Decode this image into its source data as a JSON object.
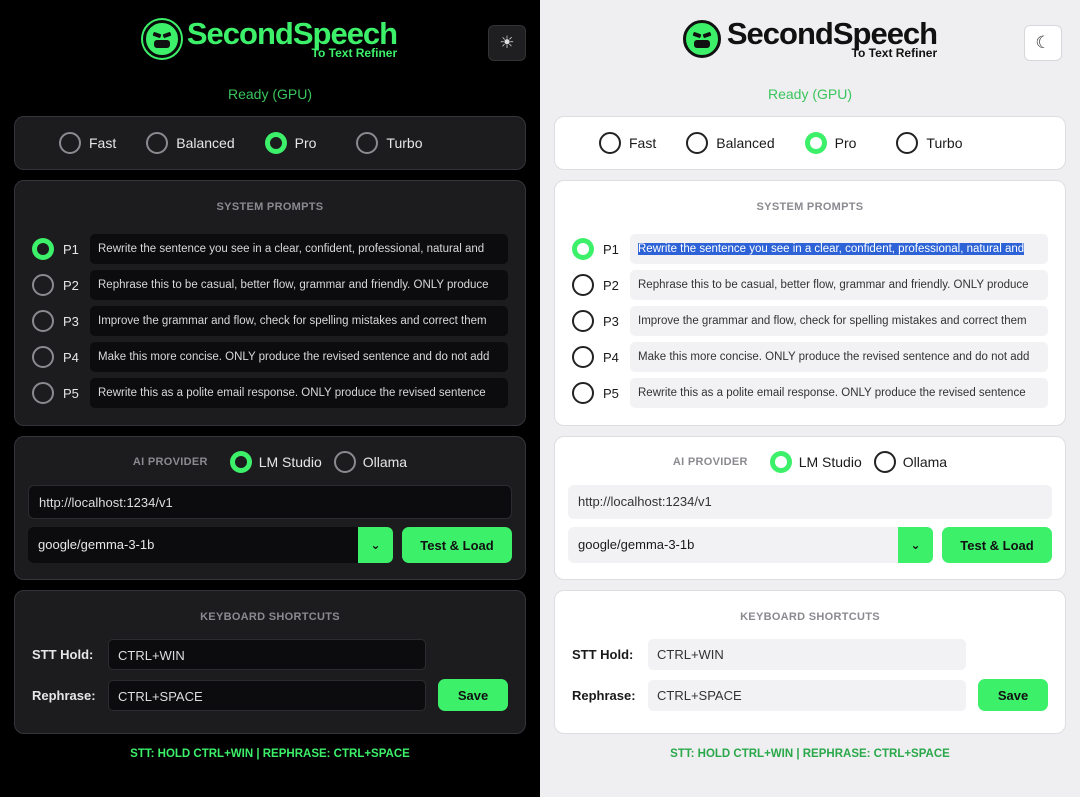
{
  "app": {
    "title": "SecondSpeech",
    "subtitle": "To Text Refiner",
    "status": "Ready (GPU)"
  },
  "themes": {
    "dark": {
      "toggle_icon": "sun-icon",
      "toggle_glyph": "☀"
    },
    "light": {
      "toggle_icon": "moon-icon",
      "toggle_glyph": "☾"
    }
  },
  "modes": [
    {
      "label": "Fast",
      "selected": false
    },
    {
      "label": "Balanced",
      "selected": false
    },
    {
      "label": "Pro",
      "selected": true
    },
    {
      "label": "Turbo",
      "selected": false
    }
  ],
  "prompts": {
    "title": "SYSTEM PROMPTS",
    "items": [
      {
        "label": "P1",
        "text": "Rewrite the sentence you see in a clear, confident, professional, natural and",
        "selected": true
      },
      {
        "label": "P2",
        "text": "Rephrase this to be casual, better flow, grammar and friendly. ONLY produce",
        "selected": false
      },
      {
        "label": "P3",
        "text": "Improve the grammar and flow, check for spelling mistakes and correct them",
        "selected": false
      },
      {
        "label": "P4",
        "text": "Make this more concise. ONLY produce the revised sentence and do not add",
        "selected": false
      },
      {
        "label": "P5",
        "text": "Rewrite this as a polite email response. ONLY produce the revised sentence",
        "selected": false
      }
    ]
  },
  "provider": {
    "title": "AI PROVIDER",
    "options": [
      {
        "label": "LM Studio",
        "selected": true
      },
      {
        "label": "Ollama",
        "selected": false
      }
    ],
    "url": "http://localhost:1234/v1",
    "model": "google/gemma-3-1b",
    "test_label": "Test & Load"
  },
  "shortcuts": {
    "title": "KEYBOARD SHORTCUTS",
    "stt_label": "STT Hold:",
    "stt_value": "CTRL+WIN",
    "rephrase_label": "Rephrase:",
    "rephrase_value": "CTRL+SPACE",
    "save_label": "Save"
  },
  "footer": "STT: HOLD CTRL+WIN  |  REPHRASE: CTRL+SPACE",
  "colors": {
    "accent": "#3df06a",
    "dark_bg": "#000000",
    "light_bg": "#efeff1"
  }
}
